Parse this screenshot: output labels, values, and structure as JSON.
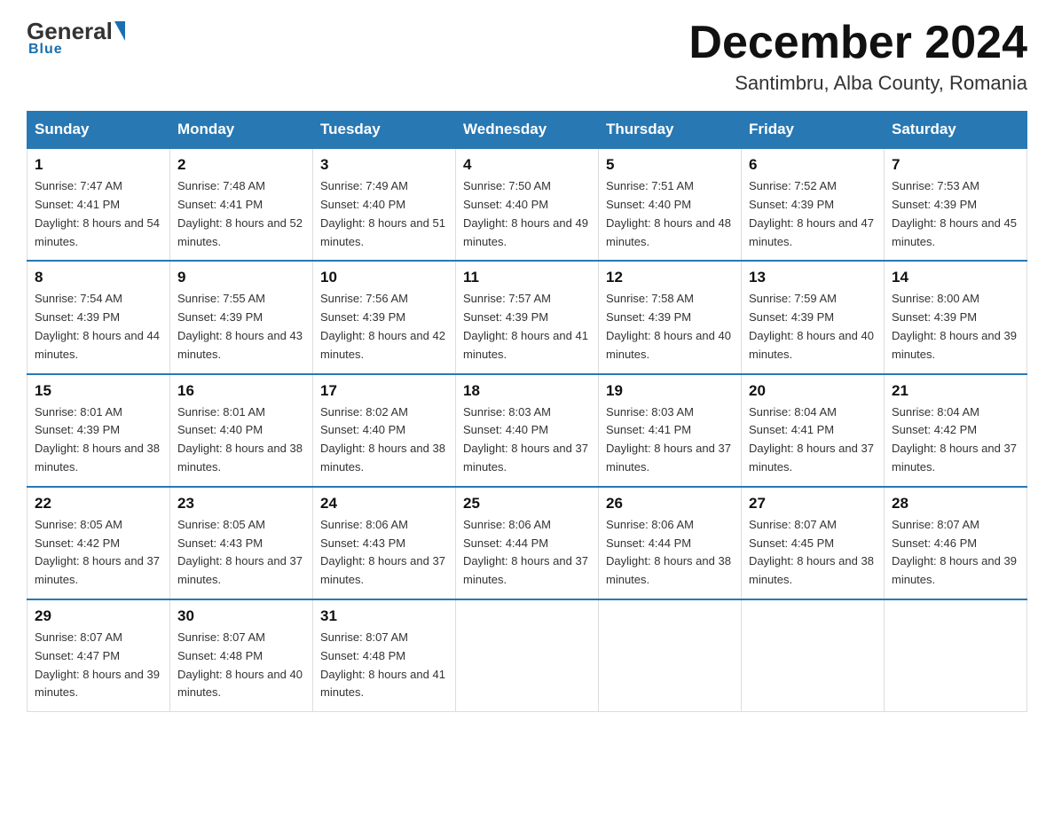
{
  "header": {
    "logo_general": "General",
    "logo_blue": "Blue",
    "month_title": "December 2024",
    "location": "Santimbru, Alba County, Romania"
  },
  "days_of_week": [
    "Sunday",
    "Monday",
    "Tuesday",
    "Wednesday",
    "Thursday",
    "Friday",
    "Saturday"
  ],
  "weeks": [
    [
      {
        "num": "1",
        "sunrise": "7:47 AM",
        "sunset": "4:41 PM",
        "daylight": "8 hours and 54 minutes."
      },
      {
        "num": "2",
        "sunrise": "7:48 AM",
        "sunset": "4:41 PM",
        "daylight": "8 hours and 52 minutes."
      },
      {
        "num": "3",
        "sunrise": "7:49 AM",
        "sunset": "4:40 PM",
        "daylight": "8 hours and 51 minutes."
      },
      {
        "num": "4",
        "sunrise": "7:50 AM",
        "sunset": "4:40 PM",
        "daylight": "8 hours and 49 minutes."
      },
      {
        "num": "5",
        "sunrise": "7:51 AM",
        "sunset": "4:40 PM",
        "daylight": "8 hours and 48 minutes."
      },
      {
        "num": "6",
        "sunrise": "7:52 AM",
        "sunset": "4:39 PM",
        "daylight": "8 hours and 47 minutes."
      },
      {
        "num": "7",
        "sunrise": "7:53 AM",
        "sunset": "4:39 PM",
        "daylight": "8 hours and 45 minutes."
      }
    ],
    [
      {
        "num": "8",
        "sunrise": "7:54 AM",
        "sunset": "4:39 PM",
        "daylight": "8 hours and 44 minutes."
      },
      {
        "num": "9",
        "sunrise": "7:55 AM",
        "sunset": "4:39 PM",
        "daylight": "8 hours and 43 minutes."
      },
      {
        "num": "10",
        "sunrise": "7:56 AM",
        "sunset": "4:39 PM",
        "daylight": "8 hours and 42 minutes."
      },
      {
        "num": "11",
        "sunrise": "7:57 AM",
        "sunset": "4:39 PM",
        "daylight": "8 hours and 41 minutes."
      },
      {
        "num": "12",
        "sunrise": "7:58 AM",
        "sunset": "4:39 PM",
        "daylight": "8 hours and 40 minutes."
      },
      {
        "num": "13",
        "sunrise": "7:59 AM",
        "sunset": "4:39 PM",
        "daylight": "8 hours and 40 minutes."
      },
      {
        "num": "14",
        "sunrise": "8:00 AM",
        "sunset": "4:39 PM",
        "daylight": "8 hours and 39 minutes."
      }
    ],
    [
      {
        "num": "15",
        "sunrise": "8:01 AM",
        "sunset": "4:39 PM",
        "daylight": "8 hours and 38 minutes."
      },
      {
        "num": "16",
        "sunrise": "8:01 AM",
        "sunset": "4:40 PM",
        "daylight": "8 hours and 38 minutes."
      },
      {
        "num": "17",
        "sunrise": "8:02 AM",
        "sunset": "4:40 PM",
        "daylight": "8 hours and 38 minutes."
      },
      {
        "num": "18",
        "sunrise": "8:03 AM",
        "sunset": "4:40 PM",
        "daylight": "8 hours and 37 minutes."
      },
      {
        "num": "19",
        "sunrise": "8:03 AM",
        "sunset": "4:41 PM",
        "daylight": "8 hours and 37 minutes."
      },
      {
        "num": "20",
        "sunrise": "8:04 AM",
        "sunset": "4:41 PM",
        "daylight": "8 hours and 37 minutes."
      },
      {
        "num": "21",
        "sunrise": "8:04 AM",
        "sunset": "4:42 PM",
        "daylight": "8 hours and 37 minutes."
      }
    ],
    [
      {
        "num": "22",
        "sunrise": "8:05 AM",
        "sunset": "4:42 PM",
        "daylight": "8 hours and 37 minutes."
      },
      {
        "num": "23",
        "sunrise": "8:05 AM",
        "sunset": "4:43 PM",
        "daylight": "8 hours and 37 minutes."
      },
      {
        "num": "24",
        "sunrise": "8:06 AM",
        "sunset": "4:43 PM",
        "daylight": "8 hours and 37 minutes."
      },
      {
        "num": "25",
        "sunrise": "8:06 AM",
        "sunset": "4:44 PM",
        "daylight": "8 hours and 37 minutes."
      },
      {
        "num": "26",
        "sunrise": "8:06 AM",
        "sunset": "4:44 PM",
        "daylight": "8 hours and 38 minutes."
      },
      {
        "num": "27",
        "sunrise": "8:07 AM",
        "sunset": "4:45 PM",
        "daylight": "8 hours and 38 minutes."
      },
      {
        "num": "28",
        "sunrise": "8:07 AM",
        "sunset": "4:46 PM",
        "daylight": "8 hours and 39 minutes."
      }
    ],
    [
      {
        "num": "29",
        "sunrise": "8:07 AM",
        "sunset": "4:47 PM",
        "daylight": "8 hours and 39 minutes."
      },
      {
        "num": "30",
        "sunrise": "8:07 AM",
        "sunset": "4:48 PM",
        "daylight": "8 hours and 40 minutes."
      },
      {
        "num": "31",
        "sunrise": "8:07 AM",
        "sunset": "4:48 PM",
        "daylight": "8 hours and 41 minutes."
      },
      null,
      null,
      null,
      null
    ]
  ]
}
